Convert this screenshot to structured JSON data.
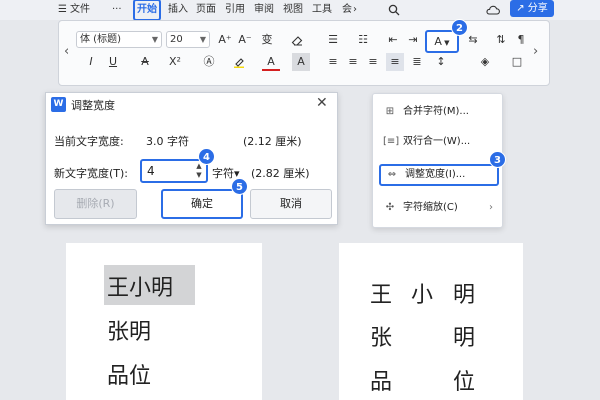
{
  "menubar": {
    "file_label": "文件",
    "more_label": "···",
    "tabs": [
      {
        "label": "开始"
      },
      {
        "label": "插入"
      },
      {
        "label": "页面"
      },
      {
        "label": "引用"
      },
      {
        "label": "审阅"
      },
      {
        "label": "视图"
      },
      {
        "label": "工具"
      },
      {
        "label": "会"
      }
    ],
    "share_label": "分享"
  },
  "ribbon": {
    "font_name": "体 (标题)",
    "font_size": "20",
    "aa_label": "A",
    "nav_left": "‹",
    "nav_right": "›"
  },
  "badges": {
    "b2": "2",
    "b3": "3",
    "b4": "4",
    "b5": "5"
  },
  "dialog": {
    "icon_label": "W",
    "title": "调整宽度",
    "current_label": "当前文字宽度:",
    "current_value": "3.0 字符",
    "current_cm": "(2.12 厘米)",
    "new_label": "新文字宽度(T):",
    "new_value": "4",
    "unit": "字符▾",
    "new_cm": "(2.82 厘米)",
    "delete_button": "删除(R)",
    "ok_button": "确定",
    "cancel_button": "取消"
  },
  "context_menu": {
    "items": [
      {
        "label": "合并字符(M)..."
      },
      {
        "label": "双行合一(W)..."
      },
      {
        "label": "调整宽度(I)..."
      },
      {
        "label": "字符缩放(C)"
      }
    ]
  },
  "pages": {
    "left_lines": [
      "王小明",
      "张明",
      "品位"
    ],
    "right_lines": [
      [
        "王",
        "小",
        "明"
      ],
      [
        "张",
        "明"
      ],
      [
        "品",
        "位"
      ]
    ]
  }
}
